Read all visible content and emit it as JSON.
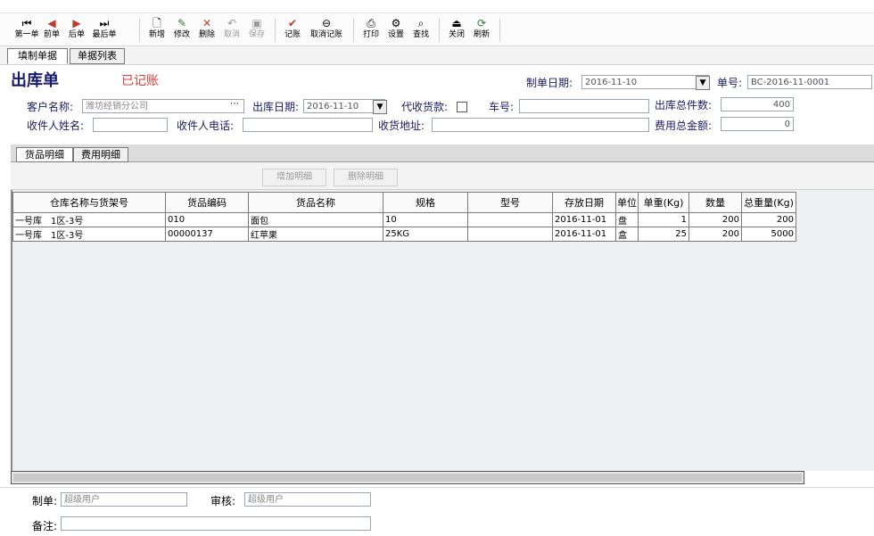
{
  "toolbar": {
    "buttons": [
      {
        "label": "第一单",
        "icon": "first-record-icon",
        "glyph": "⏮"
      },
      {
        "label": "前单",
        "icon": "prev-record-icon",
        "glyph": "◀"
      },
      {
        "label": "后单",
        "icon": "next-record-icon",
        "glyph": "▶"
      },
      {
        "label": "最后单",
        "icon": "last-record-icon",
        "glyph": "⏭"
      },
      {
        "label": "新增",
        "icon": "new-doc-icon",
        "glyph": "🗋"
      },
      {
        "label": "修改",
        "icon": "edit-icon",
        "glyph": "✎"
      },
      {
        "label": "删除",
        "icon": "delete-icon",
        "glyph": "✕"
      },
      {
        "label": "取消",
        "icon": "undo-icon",
        "glyph": "↶"
      },
      {
        "label": "保存",
        "icon": "save-icon",
        "glyph": "💾"
      },
      {
        "label": "记账",
        "icon": "check-icon",
        "glyph": "✔"
      },
      {
        "label": "取消记账",
        "icon": "cancel-post-icon",
        "glyph": "⊖"
      },
      {
        "label": "打印",
        "icon": "print-icon",
        "glyph": "⎙"
      },
      {
        "label": "设置",
        "icon": "settings-icon",
        "glyph": "⚙"
      },
      {
        "label": "查找",
        "icon": "binoculars-icon",
        "glyph": "⌕"
      },
      {
        "label": "关闭",
        "icon": "close-door-icon",
        "glyph": "⏏"
      },
      {
        "label": "刷新",
        "icon": "refresh-icon",
        "glyph": "⟳"
      }
    ]
  },
  "tabs": {
    "fill": "填制单据",
    "list": "单据列表"
  },
  "header": {
    "title": "出库单",
    "status": "已记账",
    "make_date_label": "制单日期:",
    "make_date": "2016-11-10",
    "doc_no_label": "单号:",
    "doc_no": "BC-2016-11-0001"
  },
  "form": {
    "customer_label": "客户名称:",
    "customer": "潍坊经销分公司",
    "out_date_label": "出库日期:",
    "out_date": "2016-11-10",
    "cod_label": "代收货款:",
    "plate_label": "车号:",
    "plate": "",
    "total_pieces_label": "出库总件数:",
    "total_pieces": "400",
    "receiver_label": "收件人姓名:",
    "receiver": "",
    "receiver_phone_label": "收件人电话:",
    "receiver_phone": "",
    "address_label": "收货地址:",
    "address": "",
    "fee_total_label": "费用总金额:",
    "fee_total": "0"
  },
  "detail_tabs": {
    "goods": "货品明细",
    "fees": "费用明细"
  },
  "detail_buttons": {
    "add": "增加明细",
    "remove": "删除明细"
  },
  "grid": {
    "columns": [
      "仓库名称与货架号",
      "货品编码",
      "货品名称",
      "规格",
      "型号",
      "存放日期",
      "单位",
      "单重(Kg)",
      "数量",
      "总重量(Kg)"
    ],
    "rows": [
      [
        "一号库　1区-3号",
        "010",
        "面包",
        "10",
        "",
        "2016-11-01",
        "盘",
        "1",
        "200",
        "200"
      ],
      [
        "一号库　1区-3号",
        "00000137",
        "红苹果",
        "25KG",
        "",
        "2016-11-01",
        "盒",
        "25",
        "200",
        "5000"
      ]
    ]
  },
  "footer": {
    "maker_label": "制单:",
    "maker": "超级用户",
    "auditor_label": "审核:",
    "auditor": "超级用户",
    "remark_label": "备注:",
    "remark": ""
  }
}
